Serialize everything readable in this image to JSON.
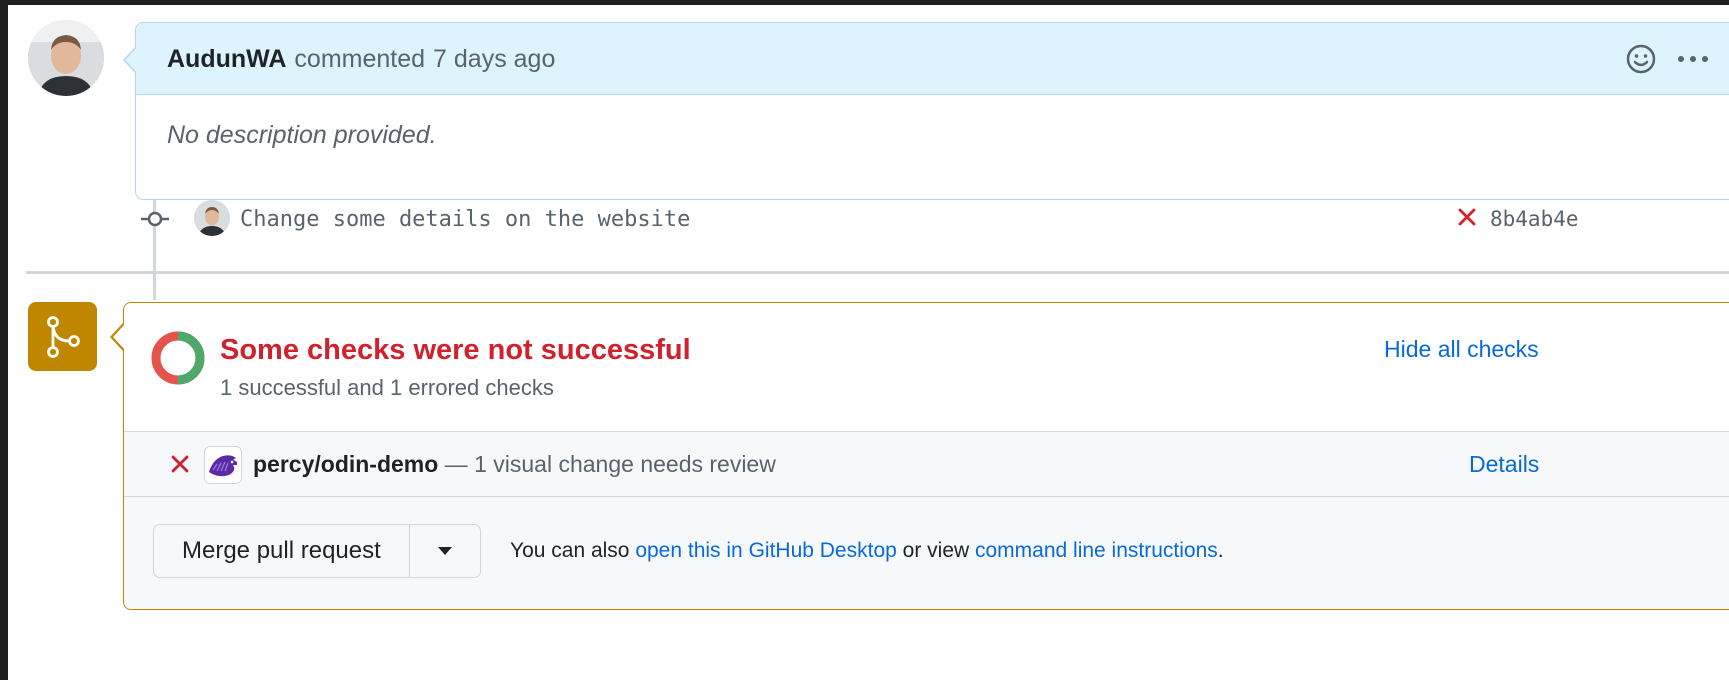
{
  "comment": {
    "author": "AudunWA",
    "action": "commented",
    "time": "7 days ago",
    "body": "No description provided."
  },
  "commit": {
    "message": "Change some details on the website",
    "sha": "8b4ab4e"
  },
  "checks": {
    "title": "Some checks were not successful",
    "summary": "1 successful and 1 errored checks",
    "hide_label": "Hide all checks",
    "success_count": 1,
    "error_count": 1,
    "items": [
      {
        "name": "percy/odin-demo",
        "description": " — 1 visual change needs review",
        "details_label": "Details"
      }
    ]
  },
  "merge": {
    "button_label": "Merge pull request",
    "note_prefix": "You can also ",
    "link_desktop": "open this in GitHub Desktop",
    "note_middle": " or view ",
    "link_cli": "command line instructions",
    "note_suffix": "."
  },
  "colors": {
    "error": "#cf222e",
    "success": "#2da44e",
    "link": "#0969da",
    "warning_border": "#bf8700"
  }
}
